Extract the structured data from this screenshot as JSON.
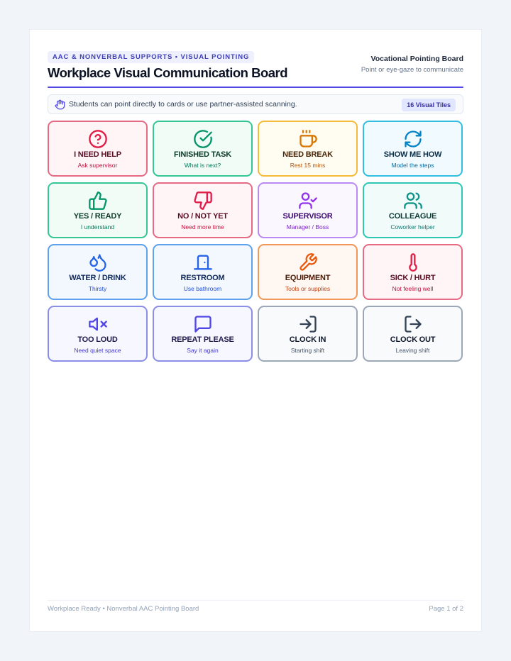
{
  "header": {
    "eyebrow": "AAC & NONVERBAL SUPPORTS • VISUAL POINTING",
    "title": "Workplace Visual Communication Board",
    "right_title": "Vocational Pointing Board",
    "right_subtitle": "Point or eye-gaze to communicate"
  },
  "note": {
    "icon": "hand-pointer-icon",
    "text": "Students can point directly to cards or use partner-assisted scanning.",
    "badge": "16 Visual Tiles"
  },
  "cards": [
    {
      "title": "I NEED HELP",
      "subtitle": "Ask supervisor",
      "icon": "help-circle-icon",
      "border": "#e76a84",
      "bg": "#fff5f7",
      "title_color": "#5b0f23",
      "sub_color": "#be123c",
      "icon_color": "#e11d48"
    },
    {
      "title": "FINISHED TASK",
      "subtitle": "What is next?",
      "icon": "check-circle-icon",
      "border": "#34c795",
      "bg": "#f1fcf7",
      "title_color": "#0c3b2b",
      "sub_color": "#047857",
      "icon_color": "#059669"
    },
    {
      "title": "NEED BREAK",
      "subtitle": "Rest 15 mins",
      "icon": "coffee-cup-icon",
      "border": "#f4bb3a",
      "bg": "#fffcf2",
      "title_color": "#4a2506",
      "sub_color": "#b45309",
      "icon_color": "#d97706"
    },
    {
      "title": "SHOW ME HOW",
      "subtitle": "Model the steps",
      "icon": "refresh-icon",
      "border": "#33bde0",
      "bg": "#f1faff",
      "title_color": "#0b2e45",
      "sub_color": "#0369a1",
      "icon_color": "#0284c7"
    },
    {
      "title": "YES / READY",
      "subtitle": "I understand",
      "icon": "thumbs-up-icon",
      "border": "#34c795",
      "bg": "#f1fcf7",
      "title_color": "#0c3b2b",
      "sub_color": "#047857",
      "icon_color": "#059669"
    },
    {
      "title": "NO / NOT YET",
      "subtitle": "Need more time",
      "icon": "thumbs-down-icon",
      "border": "#e76a84",
      "bg": "#fff5f7",
      "title_color": "#5b0f23",
      "sub_color": "#be123c",
      "icon_color": "#e11d48"
    },
    {
      "title": "SUPERVISOR",
      "subtitle": "Manager / Boss",
      "icon": "user-check-icon",
      "border": "#b98af3",
      "bg": "#fbf7ff",
      "title_color": "#3b0a73",
      "sub_color": "#7e22ce",
      "icon_color": "#9333ea"
    },
    {
      "title": "COLLEAGUE",
      "subtitle": "Coworker helper",
      "icon": "users-icon",
      "border": "#2dc7b4",
      "bg": "#f1fcfa",
      "title_color": "#0c3a36",
      "sub_color": "#0f766e",
      "icon_color": "#0d9488"
    },
    {
      "title": "WATER / DRINK",
      "subtitle": "Thirsty",
      "icon": "droplets-icon",
      "border": "#5ea1ec",
      "bg": "#f3f8ff",
      "title_color": "#102a5c",
      "sub_color": "#1d4ed8",
      "icon_color": "#2563eb"
    },
    {
      "title": "RESTROOM",
      "subtitle": "Use bathroom",
      "icon": "door-icon",
      "border": "#5ea1ec",
      "bg": "#f3f8ff",
      "title_color": "#102a5c",
      "sub_color": "#1d4ed8",
      "icon_color": "#2563eb"
    },
    {
      "title": "EQUIPMENT",
      "subtitle": "Tools or supplies",
      "icon": "wrench-icon",
      "border": "#f1975a",
      "bg": "#fff7f2",
      "title_color": "#4a1a06",
      "sub_color": "#c2410c",
      "icon_color": "#ea580c"
    },
    {
      "title": "SICK / HURT",
      "subtitle": "Not feeling well",
      "icon": "thermometer-icon",
      "border": "#e76a84",
      "bg": "#fff5f7",
      "title_color": "#5b0f23",
      "sub_color": "#be123c",
      "icon_color": "#e11d48"
    },
    {
      "title": "TOO LOUD",
      "subtitle": "Need quiet space",
      "icon": "volume-mute-icon",
      "border": "#8b8ee6",
      "bg": "#f6f7ff",
      "title_color": "#1e1b4b",
      "sub_color": "#4338ca",
      "icon_color": "#4f46e5"
    },
    {
      "title": "REPEAT PLEASE",
      "subtitle": "Say it again",
      "icon": "message-square-icon",
      "border": "#8b8ee6",
      "bg": "#f6f7ff",
      "title_color": "#1e1b4b",
      "sub_color": "#4338ca",
      "icon_color": "#4f46e5"
    },
    {
      "title": "CLOCK IN",
      "subtitle": "Starting shift",
      "icon": "log-in-icon",
      "border": "#9ca7b8",
      "bg": "#f8fafc",
      "title_color": "#0f172a",
      "sub_color": "#475569",
      "icon_color": "#334155"
    },
    {
      "title": "CLOCK OUT",
      "subtitle": "Leaving shift",
      "icon": "log-out-icon",
      "border": "#9ca7b8",
      "bg": "#f8fafc",
      "title_color": "#0f172a",
      "sub_color": "#475569",
      "icon_color": "#334155"
    }
  ],
  "footer": {
    "left": "Workplace Ready • Nonverbal AAC Pointing Board",
    "right": "Page 1 of 2"
  },
  "colors": {
    "accent": "#4f46e5",
    "page_bg": "#f1f4f9"
  }
}
